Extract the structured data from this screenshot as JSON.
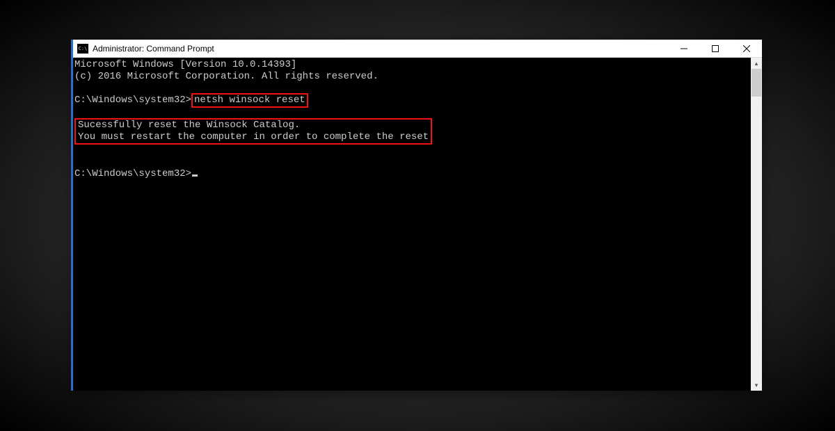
{
  "window": {
    "title": "Administrator: Command Prompt"
  },
  "terminal": {
    "line1": "Microsoft Windows [Version 10.0.14393]",
    "line2": "(c) 2016 Microsoft Corporation. All rights reserved.",
    "prompt1_prefix": "C:\\Windows\\system32>",
    "command1": "netsh winsock reset",
    "output1": "Sucessfully reset the Winsock Catalog.",
    "output2": "You must restart the computer in order to complete the reset",
    "prompt2_prefix": "C:\\Windows\\system32>"
  },
  "highlight_color": "#f21212"
}
